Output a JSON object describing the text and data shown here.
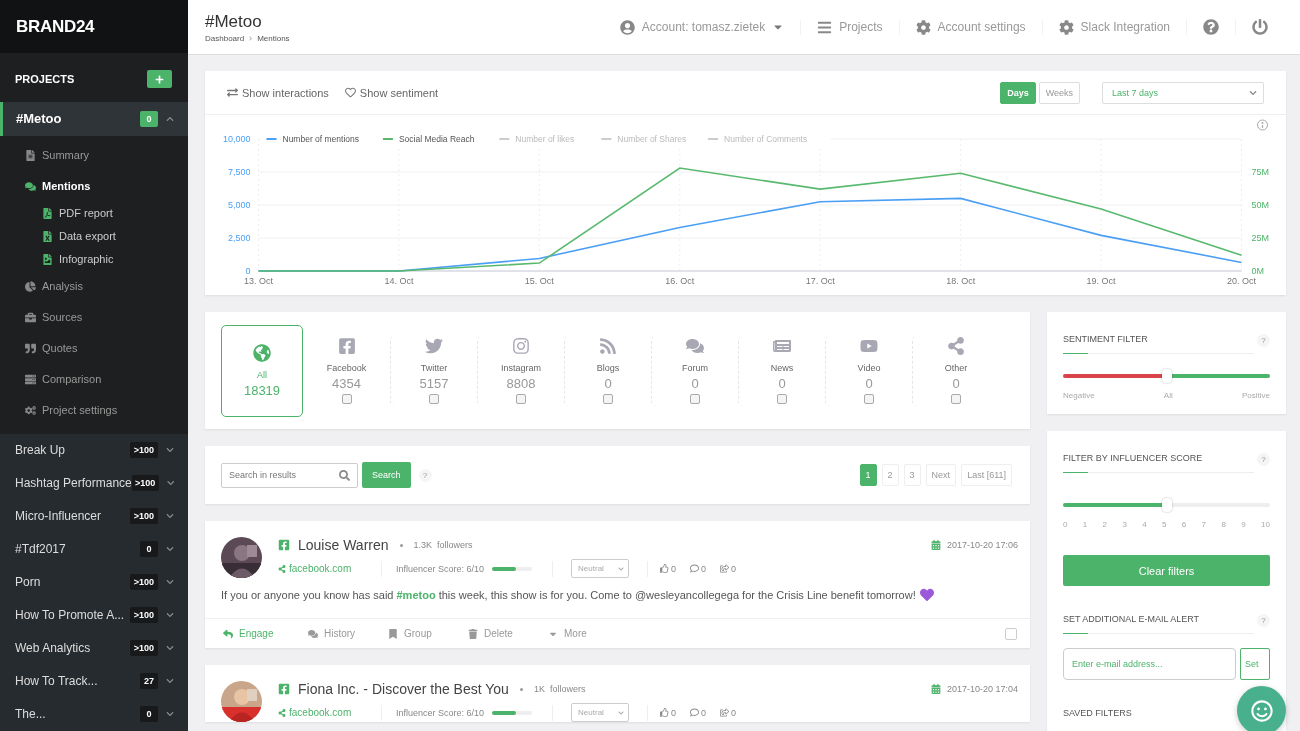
{
  "brand": "BRAND24",
  "sidebar": {
    "heading": "PROJECTS",
    "projects": [
      {
        "name": "#Metoo",
        "badge": "0",
        "selected": true,
        "expanded": true,
        "menu": [
          {
            "label": "Summary",
            "selected": false
          },
          {
            "label": "Mentions",
            "selected": true,
            "children": [
              {
                "label": "PDF report"
              },
              {
                "label": "Data export"
              },
              {
                "label": "Infographic"
              }
            ]
          },
          {
            "label": "Analysis",
            "selected": false
          },
          {
            "label": "Sources",
            "selected": false
          },
          {
            "label": "Quotes",
            "selected": false
          },
          {
            "label": "Comparison",
            "selected": false
          },
          {
            "label": "Project settings",
            "selected": false
          }
        ]
      },
      {
        "name": "Break Up",
        "badge": ">100",
        "selected": false,
        "expanded": false
      },
      {
        "name": "Hashtag Performance",
        "badge": ">100",
        "selected": false,
        "expanded": false
      },
      {
        "name": "Micro-Influencer",
        "badge": ">100",
        "selected": false,
        "expanded": false
      },
      {
        "name": "#Tdf2017",
        "badge": "0",
        "selected": false,
        "expanded": false
      },
      {
        "name": "Porn",
        "badge": ">100",
        "selected": false,
        "expanded": false
      },
      {
        "name": "How To Promote A...",
        "badge": ">100",
        "selected": false,
        "expanded": false
      },
      {
        "name": "Web Analytics",
        "badge": ">100",
        "selected": false,
        "expanded": false
      },
      {
        "name": "How To Track...",
        "badge": "27",
        "selected": false,
        "expanded": false
      },
      {
        "name": "The...",
        "badge": "0",
        "selected": false,
        "expanded": false
      }
    ]
  },
  "header": {
    "title": "#Metoo",
    "breadcrumb": [
      "Dashboard",
      "Mentions"
    ],
    "nav": [
      {
        "label": "Account: tomasz.zietek",
        "kind": "dropdown"
      },
      {
        "label": "Projects",
        "kind": "link"
      },
      {
        "label": "Account settings",
        "kind": "link"
      },
      {
        "label": "Slack Integration",
        "kind": "link"
      },
      {
        "kind": "icon"
      },
      {
        "kind": "icon"
      }
    ]
  },
  "chart_panel": {
    "toggles": [
      "Show interactions",
      "Show sentiment"
    ],
    "periods": [
      {
        "label": "Days",
        "selected": true
      },
      {
        "label": "Weeks",
        "selected": false
      }
    ],
    "range": "Last 7 days",
    "inactive_legend": [
      "Number of likes",
      "Number of Shares",
      "Number of Comments"
    ],
    "right_axis_labels": [
      "75M",
      "50M",
      "25M",
      "0M"
    ],
    "chart_data": {
      "type": "line",
      "legend": "top",
      "grid": true,
      "categories": [
        "13. Oct",
        "14. Oct",
        "15. Oct",
        "16. Oct",
        "17. Oct",
        "18. Oct",
        "19. Oct",
        "20. Oct"
      ],
      "ylim": [
        0,
        10000
      ],
      "yticks": [
        {
          "value": 0,
          "label": "0"
        },
        {
          "value": 2500,
          "label": "2,500"
        },
        {
          "value": 5000,
          "label": "5,000"
        },
        {
          "value": 7500,
          "label": "7,500"
        },
        {
          "value": 10000,
          "label": "10,000"
        }
      ],
      "series": [
        {
          "name": "Number of mentions",
          "color": "#4a9ff5",
          "values": [
            0,
            0,
            950,
            3300,
            5250,
            5500,
            2700,
            650
          ]
        },
        {
          "name": "Social Media Reach",
          "color": "#58b96e",
          "values": [
            0,
            0,
            600,
            7800,
            6200,
            7400,
            4700,
            1200
          ]
        }
      ]
    }
  },
  "sources": [
    {
      "kind": "all",
      "label": "All",
      "count": "18319",
      "selected": true
    },
    {
      "kind": "network",
      "label": "Facebook",
      "count": "4354",
      "selected": false,
      "checked": false
    },
    {
      "kind": "network",
      "label": "Twitter",
      "count": "5157",
      "selected": false,
      "checked": false
    },
    {
      "kind": "network",
      "label": "Instagram",
      "count": "8808",
      "selected": false,
      "checked": false
    },
    {
      "kind": "network",
      "label": "Blogs",
      "count": "0",
      "selected": false,
      "checked": false
    },
    {
      "kind": "network",
      "label": "Forum",
      "count": "0",
      "selected": false,
      "checked": false
    },
    {
      "kind": "network",
      "label": "News",
      "count": "0",
      "selected": false,
      "checked": false
    },
    {
      "kind": "network",
      "label": "Video",
      "count": "0",
      "selected": false,
      "checked": false
    },
    {
      "kind": "network",
      "label": "Other",
      "count": "0",
      "selected": false,
      "checked": false
    }
  ],
  "search": {
    "placeholder": "Search in results",
    "button": "Search",
    "help": "?",
    "pages": [
      {
        "label": "1",
        "selected": true
      },
      {
        "label": "2",
        "selected": false
      },
      {
        "label": "3",
        "selected": false
      },
      {
        "label": "Next",
        "selected": false
      },
      {
        "label": "Last [611]",
        "selected": false
      }
    ]
  },
  "mentions": [
    {
      "author": "Louise Warren",
      "followers": "1.3K",
      "followers_label": "followers",
      "date": "2017-10-20 17:06",
      "source": "facebook.com",
      "influencer": "Influencer Score: 6/10",
      "level": 0.6,
      "sentiment": "Neutral",
      "likes": "0",
      "comments": "0",
      "shares": "0",
      "text": "If you or anyone you know has said **#metoo** this week, this show is for you. Come to @wesleyancollegega for the Crisis Line benefit tomorrow!",
      "heart": true,
      "actions": [
        "Engage",
        "History",
        "Group",
        "Delete",
        "More"
      ],
      "checked": false
    },
    {
      "author": "Fiona Inc. - Discover the Best You",
      "followers": "1K",
      "followers_label": "followers",
      "date": "2017-10-20 17:04",
      "source": "facebook.com",
      "influencer": "Influencer Score: 6/10",
      "level": 0.6,
      "sentiment": "Neutral",
      "likes": "0",
      "comments": "0",
      "shares": "0"
    }
  ],
  "filters": {
    "sentiment": {
      "title": "SENTIMENT FILTER",
      "help": "?",
      "level": 0.5,
      "labels": [
        "Negative",
        "All",
        "Positive"
      ]
    },
    "influencer": {
      "title": "FILTER BY INFLUENCER SCORE",
      "help": "?",
      "level": 0.5,
      "ticks": [
        "0",
        "1",
        "2",
        "3",
        "4",
        "5",
        "6",
        "7",
        "8",
        "9",
        "10"
      ]
    },
    "clear_button": "Clear filters",
    "alert": {
      "title": "SET ADDITIONAL E-MAIL ALERT",
      "help": "?",
      "placeholder": "Enter e-mail address...",
      "button": "Set"
    },
    "saved_title": "SAVED FILTERS"
  }
}
